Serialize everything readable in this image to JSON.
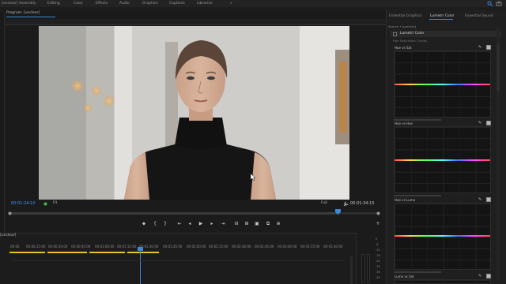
{
  "top_menu": {
    "items": [
      "[unclear]",
      "Assembly",
      "Editing",
      "Color",
      "Effects",
      "Audio",
      "Graphics",
      "Captions",
      "Libraries"
    ],
    "more": "»"
  },
  "program_monitor": {
    "title": "Program: [unclear]",
    "timecode_current": "00:01:24:10",
    "timecode_duration": "00:01:34:15",
    "zoom": "Fit",
    "resolution": "Full"
  },
  "transport": {
    "marker": "⬥",
    "in": "{",
    "out": "}",
    "go_in": "⇤",
    "step_back": "◂",
    "play": "▶",
    "step_fwd": "▸",
    "go_out": "⇥",
    "lift": "⊟",
    "extract": "⊞",
    "export_frame": "▣",
    "compare": "⧉",
    "more": "⊕"
  },
  "sequence": {
    "tab": "[unclear]",
    "ticks": [
      "00:00",
      "00:00:15:00",
      "00:00:30:00",
      "00:00:45:00",
      "00:01:00:00",
      "00:01:15:00",
      "00:01:30:00",
      "00:01:45:00",
      "00:02:00:00",
      "00:02:15:00",
      "00:02:30:00",
      "00:02:45:00",
      "00:03:00:00",
      "00:03:15:00",
      "00:03:30:00"
    ],
    "clip_color": "#e8c227"
  },
  "audio_meter": {
    "scale": [
      "0",
      "-6",
      "-12",
      "-18",
      "-24",
      "-30",
      "-36",
      "-42"
    ]
  },
  "right_panel": {
    "tabs": [
      "Essential Graphics",
      "Lumetri Color",
      "Essential Sound"
    ],
    "active_tab": "Lumetri Color",
    "source_line": "Source • [unclear]",
    "header": "Lumetri Color",
    "section_hint": "Hue Saturation Curves",
    "curves": [
      {
        "label": "Hue vs Sat"
      },
      {
        "label": "Hue vs Hue"
      },
      {
        "label": "Hue vs Luma"
      },
      {
        "label": "Luma vs Sat"
      }
    ]
  },
  "colors": {
    "accent": "#3b88d6",
    "timecode": "#3f98ff",
    "panel_bg": "#1d1d1d"
  }
}
